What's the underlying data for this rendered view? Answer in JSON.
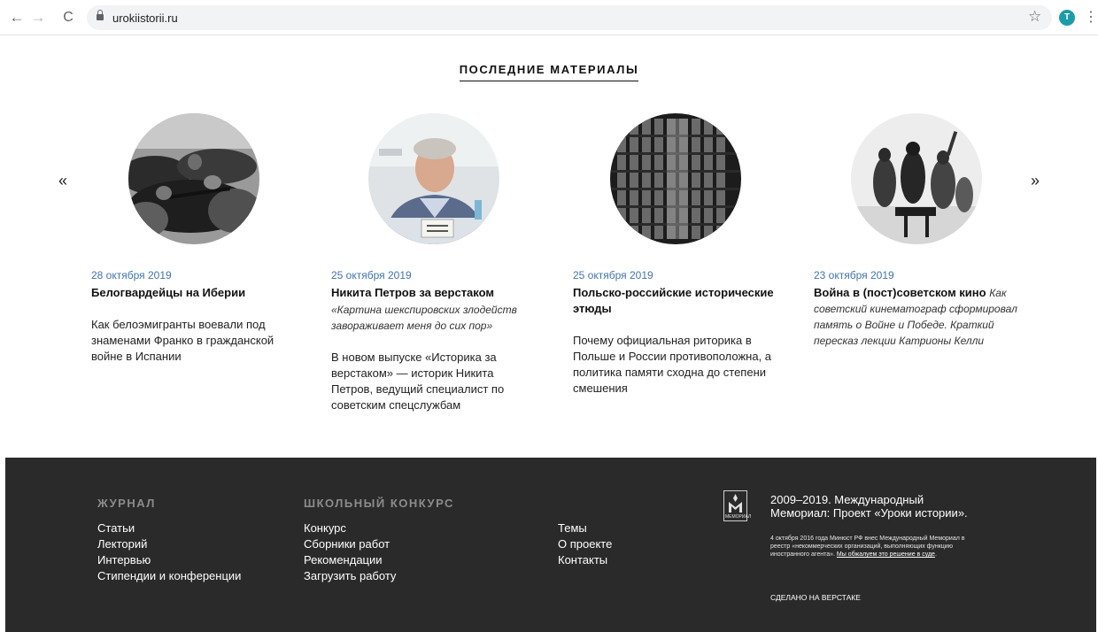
{
  "browser": {
    "url": "urokiistorii.ru",
    "profile_initial": "T",
    "back_icon": "←",
    "forward_icon": "→",
    "reload_icon": "C",
    "star_icon": "☆",
    "menu_icon": "⋮"
  },
  "latest": {
    "title": "ПОСЛЕДНИЕ МАТЕРИАЛЫ",
    "prev_label": "«",
    "next_label": "»",
    "cards": [
      {
        "date": "28 октября 2019",
        "title": "Белогвардейцы на Иберии",
        "title_lead": "",
        "subtitle": "",
        "description": "Как белоэмигранты воевали под знаменами Франко в гражданской войне в Испании"
      },
      {
        "date": "25 октября 2019",
        "title": "Никита Петров за верстаком",
        "title_lead": "",
        "subtitle": "«Картина шекспировских злодейств завораживает меня до сих пор»",
        "description": "В новом выпуске «Историка за верстаком» — историк Никита Петров, ведущий специалист по советским спецслужбам"
      },
      {
        "date": "25 октября 2019",
        "title": "Польско-российские исторические этюды",
        "title_lead": "",
        "subtitle": "",
        "description": "Почему официальная риторика в Польше и России противоположна, а политика памяти сходна до степени смешения"
      },
      {
        "date": "23 октября 2019",
        "title": "Война в (пост)советском кино",
        "title_lead": "Как советский кинематограф сформировал память о Войне и Победе. Краткий пересказ лекции Катрионы Келли",
        "subtitle": "",
        "description": ""
      }
    ]
  },
  "footer": {
    "journal": {
      "heading": "ЖУРНАЛ",
      "links": [
        "Статьи",
        "Лекторий",
        "Интервью",
        "Стипендии и конференции"
      ]
    },
    "contest": {
      "heading": "ШКОЛЬНЫЙ КОНКУРС",
      "links": [
        "Конкурс",
        "Сборники работ",
        "Рекомендации",
        "Загрузить работу"
      ]
    },
    "misc": {
      "links": [
        "Темы",
        "О проекте",
        "Контакты"
      ]
    },
    "logo_text": "МЕМОРИАЛ",
    "copyright": "2009–2019. Международный Мемориал: Проект «Уроки истории».",
    "legal_text": "4 октября 2016 года Минюст РФ внес Международный Мемориал в реестр «некоммерческих организаций, выполняющих функцию иностранного агента».",
    "legal_link": "Мы обжалуем это решение в суде",
    "legal_end": ".",
    "made_by": "СДЕЛАНО НА ВЕРСТАКЕ"
  }
}
